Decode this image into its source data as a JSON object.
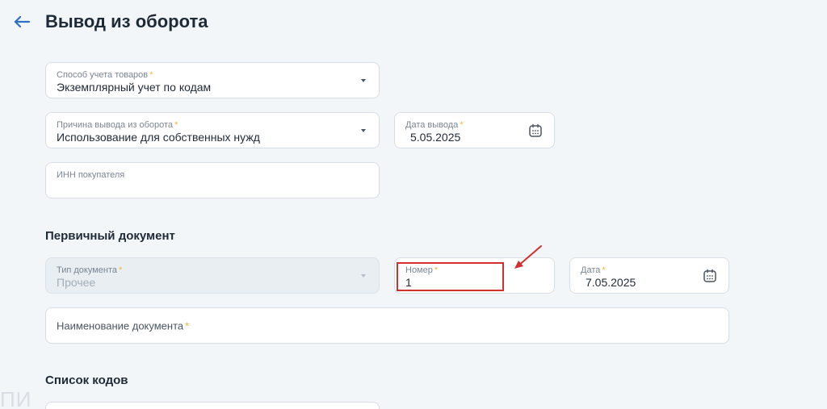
{
  "header": {
    "title": "Вывод из оборота"
  },
  "form": {
    "accounting_method": {
      "label": "Способ учета товаров",
      "required": "*",
      "value": "Экземплярный учет по кодам"
    },
    "withdrawal_reason": {
      "label": "Причина вывода из оборота",
      "required": "*",
      "value": "Использование для собственных нужд"
    },
    "withdrawal_date": {
      "label": "Дата вывода",
      "required": "*",
      "value": "5.05.2025"
    },
    "buyer_inn": {
      "label": "ИНН покупателя",
      "value": ""
    }
  },
  "primary_document": {
    "section_title": "Первичный документ",
    "doc_type": {
      "label": "Тип документа",
      "required": "*",
      "value": "Прочее"
    },
    "number": {
      "label": "Номер",
      "required": "*",
      "value": "1"
    },
    "date": {
      "label": "Дата",
      "required": "*",
      "value": "7.05.2025"
    },
    "doc_name": {
      "label": "Наименование документа",
      "required": "*"
    }
  },
  "codes": {
    "section_title": "Список кодов"
  },
  "watermark": "ПИ",
  "colors": {
    "accent": "#2f6fc4",
    "required": "#f0b53a",
    "highlight": "#d32f2f"
  }
}
